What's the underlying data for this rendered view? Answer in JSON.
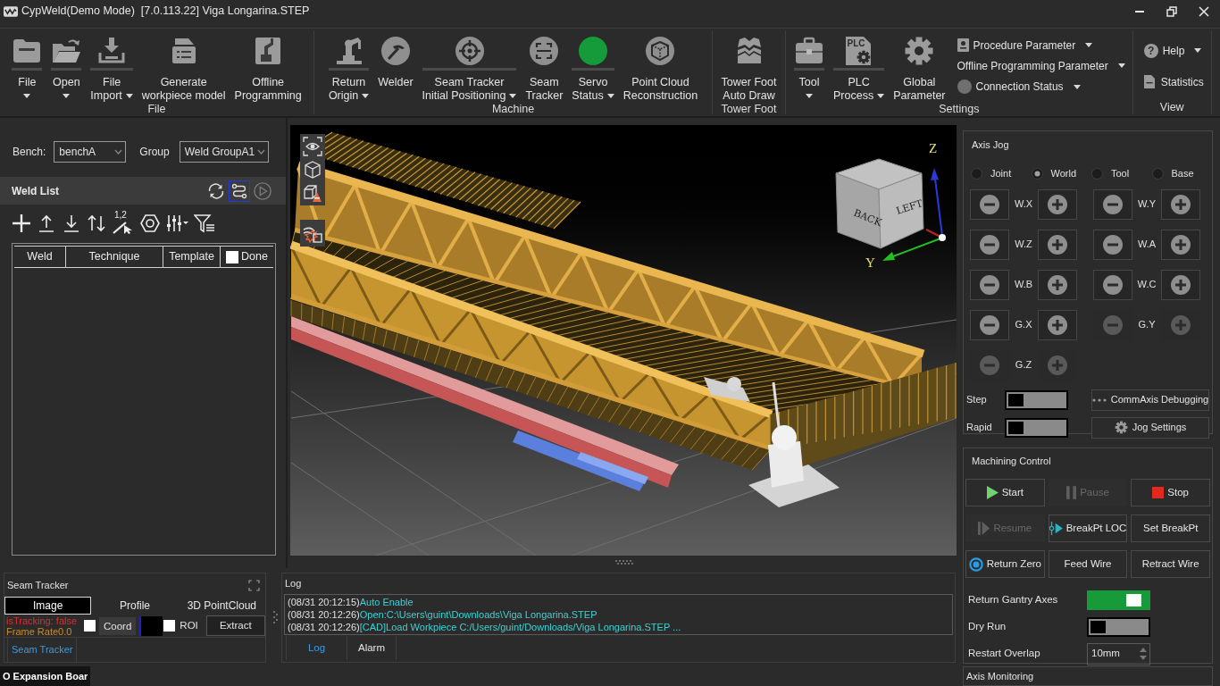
{
  "window": {
    "title": "CypWeld(Demo Mode)  [7.0.113.22] Viga Longarina.STEP"
  },
  "ribbon": {
    "groups": [
      {
        "label": "File",
        "items": [
          {
            "kind": "split",
            "lines": [
              "File"
            ],
            "dropdown": true
          },
          {
            "kind": "split",
            "lines": [
              "Open"
            ],
            "dropdown": true
          },
          {
            "kind": "split",
            "lines": [
              "File",
              "Import"
            ],
            "dropdown": true
          },
          {
            "kind": "button",
            "lines": [
              "Generate",
              "workpiece model"
            ],
            "dropdown": false
          },
          {
            "kind": "button",
            "lines": [
              "Offline",
              "Programming"
            ],
            "dropdown": false
          }
        ]
      },
      {
        "label": "Machine",
        "items": [
          {
            "kind": "split",
            "lines": [
              "Return",
              "Origin"
            ],
            "dropdown": true
          },
          {
            "kind": "button",
            "lines": [
              "Welder"
            ],
            "dropdown": false
          },
          {
            "kind": "split",
            "lines": [
              "Seam Tracker",
              "Initial Positioning"
            ],
            "dropdown": true
          },
          {
            "kind": "button",
            "lines": [
              "Seam",
              "Tracker"
            ],
            "dropdown": false
          },
          {
            "kind": "split",
            "lines": [
              "Servo",
              "Status"
            ],
            "dropdown": true,
            "color": "#169b3a"
          },
          {
            "kind": "button",
            "lines": [
              "Point Cloud",
              "Reconstruction"
            ],
            "dropdown": false
          }
        ]
      },
      {
        "label": "Tower Foot",
        "items": [
          {
            "kind": "button",
            "lines": [
              "Tower Foot",
              "Auto Draw"
            ],
            "dropdown": false
          }
        ]
      },
      {
        "label": "Settings",
        "items": [
          {
            "kind": "split",
            "lines": [
              "Tool"
            ],
            "dropdown": true
          },
          {
            "kind": "split",
            "lines": [
              "PLC",
              "Process"
            ],
            "dropdown": true,
            "icon_text": "PLC"
          },
          {
            "kind": "button",
            "lines": [
              "Global",
              "Parameter"
            ],
            "dropdown": false
          }
        ],
        "small_items": [
          {
            "label": "Procedure Parameter",
            "dropdown": true
          },
          {
            "label": "Offline Programming Parameter",
            "dropdown": true
          },
          {
            "label": "Connection Status",
            "dropdown": true,
            "color": "#707070"
          }
        ]
      },
      {
        "label": "View",
        "small_items": [
          {
            "label": "Help",
            "dropdown": true,
            "icon_text": "?"
          },
          {
            "label": "Statistics",
            "dropdown": false
          }
        ]
      }
    ]
  },
  "bench": {
    "label": "Bench:",
    "value": "benchA"
  },
  "group": {
    "label": "Group",
    "value": "Weld GroupA1"
  },
  "weld_list": {
    "title": "Weld List",
    "header_tools": [
      {
        "selected": false
      },
      {
        "selected": true
      },
      {
        "selected": false
      }
    ],
    "renumber_label": "1,2",
    "columns": [
      {
        "label": "Weld",
        "kind": "text"
      },
      {
        "label": "Technique",
        "kind": "text"
      },
      {
        "label": "Template",
        "kind": "text"
      },
      {
        "label": "Done",
        "kind": "checkbox",
        "checked": false
      }
    ]
  },
  "viewport": {
    "cube_faces": [
      "BACK",
      "LEFT"
    ],
    "axis_labels": [
      "Z",
      "Y"
    ]
  },
  "seam_tracker": {
    "title": "Seam Tracker",
    "tabs": [
      {
        "label": "Image",
        "selected": true
      },
      {
        "label": "Profile",
        "selected": false
      },
      {
        "label": "3D PointCloud",
        "selected": false
      }
    ],
    "status": [
      {
        "text": "isTracking: false",
        "color": "#e02a2a"
      },
      {
        "text": "Frame Rate0.0",
        "color": "#d08a1e"
      }
    ],
    "options": [
      {
        "label": "Coord",
        "checked": false
      },
      {
        "label": "ROI",
        "checked": false
      }
    ],
    "extract_button": "Extract",
    "bottom_tabs": [
      {
        "label": "Seam Tracker",
        "selected": true
      }
    ]
  },
  "log": {
    "title": "Log",
    "lines": [
      {
        "time": "(08/31 20:12:15)",
        "message": "Auto Enable"
      },
      {
        "time": "(08/31 20:12:26)",
        "message": "Open:C:\\Users\\guint\\Downloads\\Viga Longarina.STEP"
      },
      {
        "time": "(08/31 20:12:26)",
        "message": "[CAD]Load Workpiece C:/Users/guint/Downloads/Viga Longarina.STEP ..."
      }
    ],
    "tabs": [
      {
        "label": "Log",
        "selected": true
      },
      {
        "label": "Alarm",
        "selected": false
      }
    ]
  },
  "bottom_dock": {
    "tab": "O Expansion Boar"
  },
  "axis_jog": {
    "title": "Axis Jog",
    "modes": [
      {
        "label": "Joint",
        "selected": false
      },
      {
        "label": "World",
        "selected": true
      },
      {
        "label": "Tool",
        "selected": false
      },
      {
        "label": "Base",
        "selected": false
      }
    ],
    "axes": [
      {
        "label": "W.X",
        "disabled": false
      },
      {
        "label": "W.Y",
        "disabled": false
      },
      {
        "label": "W.Z",
        "disabled": false
      },
      {
        "label": "W.A",
        "disabled": false
      },
      {
        "label": "W.B",
        "disabled": false
      },
      {
        "label": "W.C",
        "disabled": false
      },
      {
        "label": "G.X",
        "disabled": false
      },
      {
        "label": "G.Y",
        "disabled": true
      },
      {
        "label": "G.Z",
        "disabled": true
      }
    ],
    "toggles": [
      {
        "label": "Step",
        "on": false
      },
      {
        "label": "Rapid",
        "on": false
      }
    ],
    "buttons": [
      {
        "label": "CommAxis Debugging"
      },
      {
        "label": "Jog Settings"
      }
    ]
  },
  "machining": {
    "title": "Machining Control",
    "buttons": [
      {
        "label": "Start",
        "disabled": false
      },
      {
        "label": "Pause",
        "disabled": true
      },
      {
        "label": "Stop",
        "disabled": false
      },
      {
        "label": "Resume",
        "disabled": true
      },
      {
        "label": "BreakPt LOC",
        "disabled": false
      },
      {
        "label": "Set BreakPt",
        "disabled": false
      },
      {
        "label": "Return Zero",
        "disabled": false
      },
      {
        "label": "Feed Wire",
        "disabled": false
      },
      {
        "label": "Retract Wire",
        "disabled": false
      }
    ],
    "toggles": [
      {
        "label": "Return Gantry Axes",
        "on": true
      },
      {
        "label": "Dry Run",
        "on": false
      }
    ],
    "overlap": {
      "label": "Restart Overlap",
      "value": "10mm"
    }
  },
  "axis_monitoring": {
    "title": "Axis Monitoring"
  }
}
